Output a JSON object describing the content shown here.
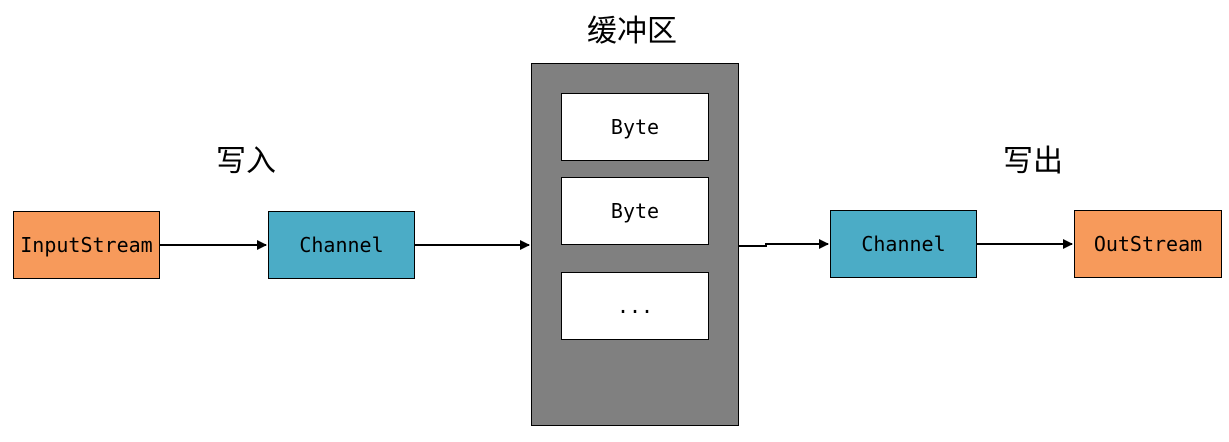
{
  "diagram": {
    "buffer_title": "缓冲区",
    "write_in_label": "写入",
    "write_out_label": "写出",
    "input_stream": "InputStream",
    "channel_in": "Channel",
    "channel_out": "Channel",
    "out_stream": "OutStream",
    "buffer_items": [
      "Byte",
      "Byte",
      "..."
    ]
  },
  "colors": {
    "stream": "#f79a5b",
    "channel": "#4bacc6",
    "buffer": "#808080",
    "cell": "#ffffff"
  }
}
